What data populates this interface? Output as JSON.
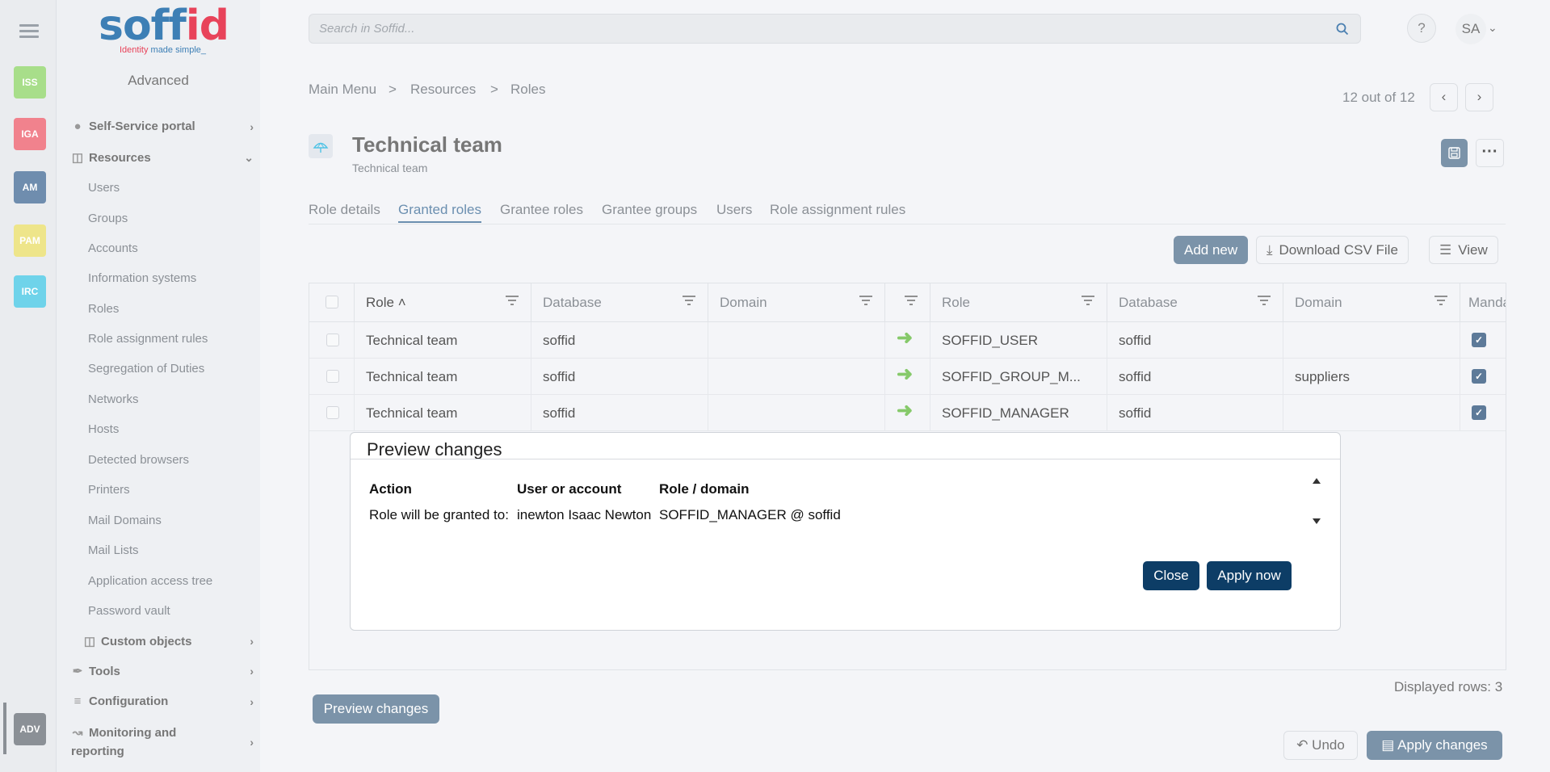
{
  "rail": {
    "buttons": [
      {
        "label": "ISS",
        "color": "#a8de8a"
      },
      {
        "label": "IGA",
        "color": "#f1828d"
      },
      {
        "label": "AM",
        "color": "#6f8dae"
      },
      {
        "label": "PAM",
        "color": "#eee58a"
      },
      {
        "label": "IRC",
        "color": "#6fd3ea"
      },
      {
        "label": "ADV",
        "color": "#8b9096"
      }
    ]
  },
  "sidebar": {
    "logo_main_1": "soff",
    "logo_main_2": "id",
    "logo_tag_1": "Identity",
    "logo_tag_2": " made simple_",
    "section_title": "Advanced",
    "groups": {
      "self_service": "Self-Service portal",
      "resources": "Resources",
      "custom_objects": "Custom objects",
      "tools": "Tools",
      "configuration": "Configuration",
      "monitoring_1": "Monitoring and",
      "monitoring_2": "reporting"
    },
    "resource_items": [
      "Users",
      "Groups",
      "Accounts",
      "Information systems",
      "Roles",
      "Role assignment rules",
      "Segregation of Duties",
      "Networks",
      "Hosts",
      "Detected browsers",
      "Printers",
      "Mail Domains",
      "Mail Lists",
      "Application access tree",
      "Password vault"
    ]
  },
  "header": {
    "search_placeholder": "Search in Soffid...",
    "help": "?",
    "avatar": "SA"
  },
  "breadcrumb": {
    "items": [
      "Main Menu",
      "Resources",
      "Roles"
    ],
    "separator": ">"
  },
  "pager": {
    "text": "12 out of 12"
  },
  "page": {
    "title": "Technical team",
    "subtitle": "Technical team"
  },
  "tabs": [
    "Role details",
    "Granted roles",
    "Grantee roles",
    "Grantee groups",
    "Users",
    "Role assignment rules"
  ],
  "toolbar": {
    "add_new": "Add new",
    "download_csv": "Download CSV File",
    "view": "View"
  },
  "table": {
    "columns": [
      "Role",
      "Database",
      "Domain",
      "",
      "Role",
      "Database",
      "Domain",
      "Manda"
    ],
    "rows": [
      {
        "role": "Technical team",
        "database": "soffid",
        "domain": "",
        "granted_role": "SOFFID_USER",
        "granted_db": "soffid",
        "granted_domain": "",
        "mandatory": true
      },
      {
        "role": "Technical team",
        "database": "soffid",
        "domain": "",
        "granted_role": "SOFFID_GROUP_M...",
        "granted_db": "soffid",
        "granted_domain": "suppliers",
        "mandatory": true
      },
      {
        "role": "Technical team",
        "database": "soffid",
        "domain": "",
        "granted_role": "SOFFID_MANAGER",
        "granted_db": "soffid",
        "granted_domain": "",
        "mandatory": true
      }
    ],
    "displayed_rows": "Displayed rows: 3"
  },
  "modal": {
    "title": "Preview changes",
    "headers": [
      "Action",
      "User or account",
      "Role / domain"
    ],
    "row": [
      "Role will be granted to:",
      "inewton Isaac Newton",
      "SOFFID_MANAGER @ soffid"
    ],
    "close": "Close",
    "apply_now": "Apply now"
  },
  "footer": {
    "preview_changes": "Preview changes",
    "undo": "Undo",
    "apply_changes": "Apply changes"
  }
}
